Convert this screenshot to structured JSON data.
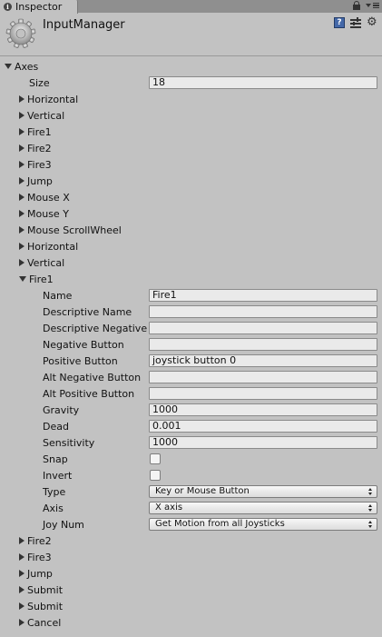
{
  "tab": {
    "title": "Inspector"
  },
  "header": {
    "title": "InputManager"
  },
  "axes": {
    "label": "Axes",
    "size_label": "Size",
    "size_value": "18",
    "items_before": [
      "Horizontal",
      "Vertical",
      "Fire1",
      "Fire2",
      "Fire3",
      "Jump",
      "Mouse X",
      "Mouse Y",
      "Mouse ScrollWheel",
      "Horizontal",
      "Vertical"
    ],
    "expanded": {
      "label": "Fire1",
      "name_label": "Name",
      "name_value": "Fire1",
      "desc_name_label": "Descriptive Name",
      "desc_name_value": "",
      "desc_neg_label": "Descriptive Negative",
      "desc_neg_value": "",
      "neg_button_label": "Negative Button",
      "neg_button_value": "",
      "pos_button_label": "Positive Button",
      "pos_button_value": "joystick button 0",
      "alt_neg_label": "Alt Negative Button",
      "alt_neg_value": "",
      "alt_pos_label": "Alt Positive Button",
      "alt_pos_value": "",
      "gravity_label": "Gravity",
      "gravity_value": "1000",
      "dead_label": "Dead",
      "dead_value": "0.001",
      "sensitivity_label": "Sensitivity",
      "sensitivity_value": "1000",
      "snap_label": "Snap",
      "snap_checked": false,
      "invert_label": "Invert",
      "invert_checked": false,
      "type_label": "Type",
      "type_value": "Key or Mouse Button",
      "axis_label": "Axis",
      "axis_value": "X axis",
      "joynum_label": "Joy Num",
      "joynum_value": "Get Motion from all Joysticks"
    },
    "items_after": [
      "Fire2",
      "Fire3",
      "Jump",
      "Submit",
      "Submit",
      "Cancel"
    ]
  }
}
